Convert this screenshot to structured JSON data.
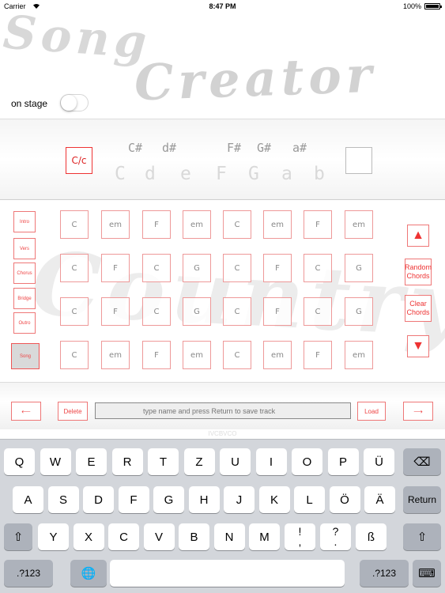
{
  "status_bar": {
    "carrier": "Carrier",
    "time": "8:47 PM",
    "battery": "100%"
  },
  "app_title": {
    "line1": "Song",
    "line2": "Creator"
  },
  "on_stage": {
    "label": "on stage",
    "enabled": false
  },
  "key_selector": {
    "left_button": "C/c",
    "right_button": "",
    "sharps": [
      "C#",
      "d#",
      "F#",
      "G#",
      "a#"
    ],
    "naturals": [
      "C",
      "d",
      "e",
      "F",
      "G",
      "a",
      "b"
    ]
  },
  "genre": "Country",
  "sections": [
    "Intro",
    "Vers",
    "Chorus",
    "Bridge",
    "Outro",
    "Song"
  ],
  "chord_rows": [
    [
      "C",
      "em",
      "F",
      "em",
      "C",
      "em",
      "F",
      "em"
    ],
    [
      "C",
      "F",
      "C",
      "G",
      "C",
      "F",
      "C",
      "G"
    ],
    [
      "C",
      "F",
      "C",
      "G",
      "C",
      "F",
      "C",
      "G"
    ],
    [
      "C",
      "em",
      "F",
      "em",
      "C",
      "em",
      "F",
      "em"
    ]
  ],
  "side_buttons": {
    "up_icon": "triangle-up-icon",
    "random": "Random Chords",
    "clear": "Clear Chords",
    "down_icon": "triangle-down-icon"
  },
  "track_bar": {
    "delete": "Delete",
    "input_placeholder": "type name and press Return to save track",
    "load": "Load",
    "watermark": "IVCBVCO"
  },
  "keyboard": {
    "row1": [
      "Q",
      "W",
      "E",
      "R",
      "T",
      "Z",
      "U",
      "I",
      "O",
      "P",
      "Ü"
    ],
    "row2": [
      "A",
      "S",
      "D",
      "F",
      "G",
      "H",
      "J",
      "K",
      "L",
      "Ö",
      "Ä"
    ],
    "row3": [
      "Y",
      "X",
      "C",
      "V",
      "B",
      "N",
      "M"
    ],
    "punct1": [
      "!",
      ","
    ],
    "punct2": [
      "?",
      "."
    ],
    "eszett": "ß",
    "return": "Return",
    "numbers": ".?123",
    "colors": {
      "keyboard_bg": "#d3d6db",
      "accent_red": "#e33333"
    }
  }
}
